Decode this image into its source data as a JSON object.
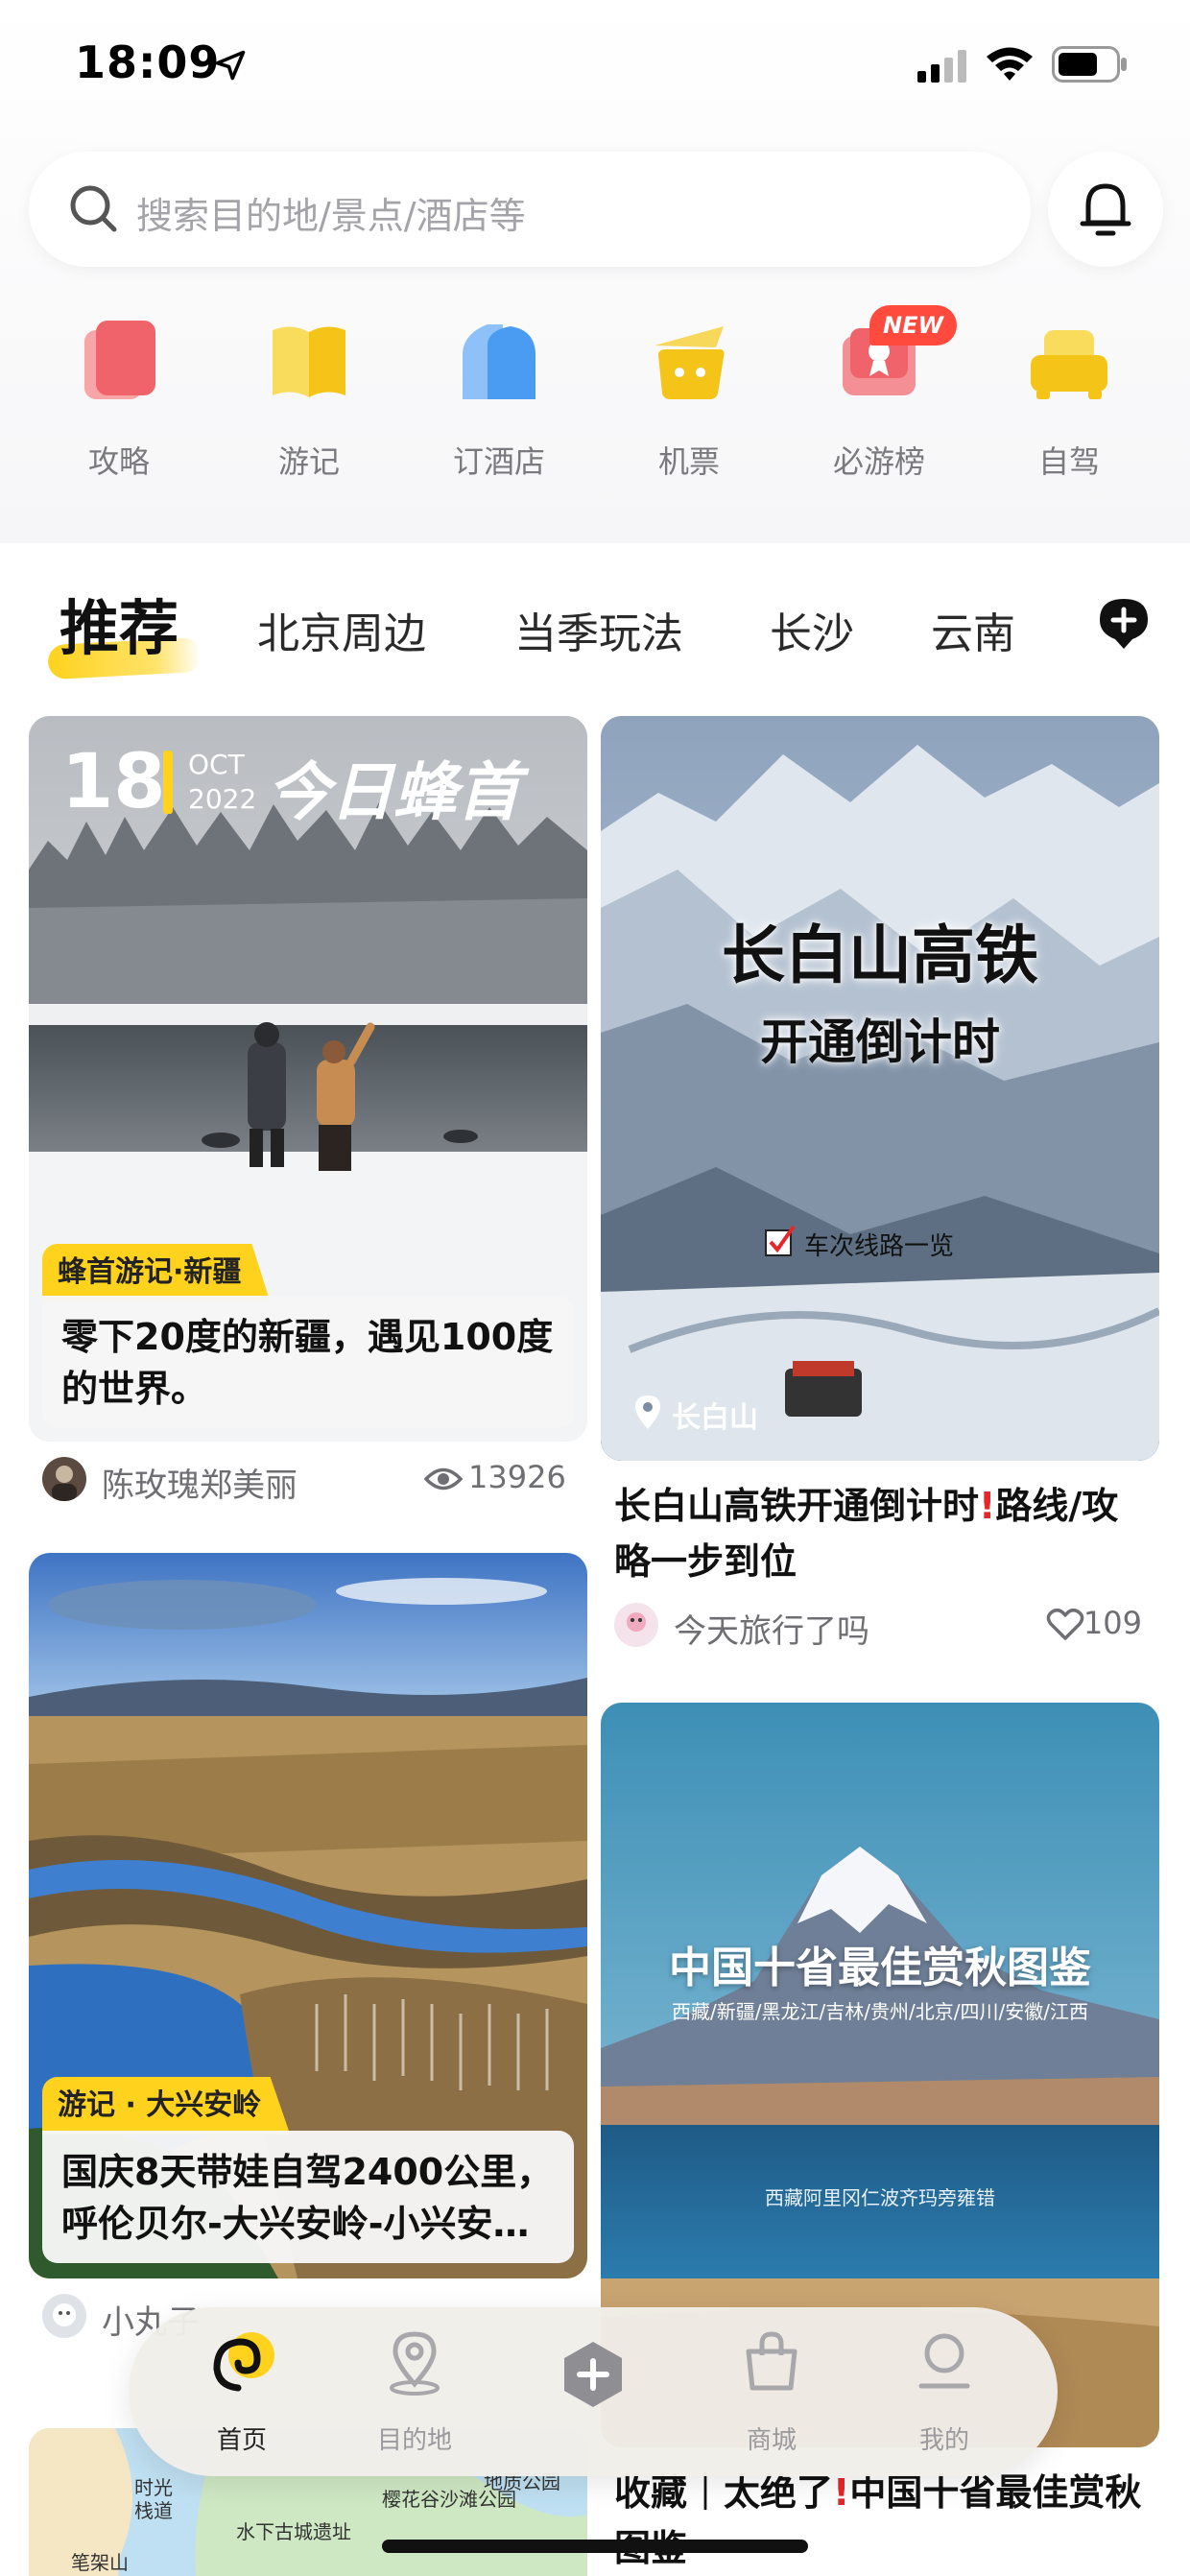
{
  "status_bar": {
    "time": "18:09"
  },
  "search": {
    "placeholder": "搜索目的地/景点/酒店等"
  },
  "quick_nav": [
    {
      "label": "攻略",
      "icon": "guide-icon",
      "color": "#f0636a"
    },
    {
      "label": "游记",
      "icon": "travelnote-icon",
      "color": "#f7cf2c"
    },
    {
      "label": "订酒店",
      "icon": "hotel-icon",
      "color": "#4a9cf3"
    },
    {
      "label": "机票",
      "icon": "flight-icon",
      "color": "#f7d02e"
    },
    {
      "label": "必游榜",
      "icon": "ranking-icon",
      "color": "#f06670",
      "badge": "NEW"
    },
    {
      "label": "自驾",
      "icon": "car-icon",
      "color": "#f8c91f"
    }
  ],
  "tabs": {
    "active": "推荐",
    "items": [
      "北京周边",
      "当季玩法",
      "长沙",
      "云南"
    ]
  },
  "cards": {
    "c1": {
      "date_day": "18",
      "date_month": "OCT",
      "date_year": "2022",
      "banner": "今日蜂首",
      "tag": "蜂首游记·新疆",
      "title": "零下20度的新疆，遇见100度的世界。",
      "author": "陈玫瑰郑美丽",
      "views": "13926"
    },
    "c2": {
      "img_title": "长白山高铁",
      "img_subtitle": "开通倒计时",
      "img_caption": "车次线路一览",
      "location": "长白山",
      "title_a": "长白山高铁开通倒计时",
      "title_b": "路线/攻略一步到位",
      "author": "今天旅行了吗",
      "likes": "109"
    },
    "c3": {
      "tag": "游记 · 大兴安岭",
      "title": "国庆8天带娃自驾2400公里，呼伦贝尔-大兴安岭-小兴安…",
      "author": "小丸子"
    },
    "c4": {
      "img_title": "中国十省最佳赏秋图鉴",
      "img_subtitle": "西藏/新疆/黑龙江/吉林/贵州/北京/四川/安徽/江西",
      "img_caption": "西藏阿里冈仁波齐玛旁雍错",
      "title_a": "收藏｜太绝了",
      "title_b": "中国十省最佳赏秋图鉴"
    },
    "c5": {
      "map_labels": [
        "时光栈道",
        "樱花谷沙滩公园",
        "地质公园",
        "水下古城遗址",
        "笔架山"
      ]
    }
  },
  "bottom_nav": [
    {
      "label": "首页",
      "icon": "home-icon",
      "active": true
    },
    {
      "label": "目的地",
      "icon": "destination-icon",
      "active": false
    },
    {
      "label": "",
      "icon": "plus-icon",
      "active": false
    },
    {
      "label": "商城",
      "icon": "shop-icon",
      "active": false
    },
    {
      "label": "我的",
      "icon": "profile-icon",
      "active": false
    }
  ],
  "colors": {
    "accent_yellow": "#ffd21e",
    "tag_red": "#e8262a",
    "text_grey": "#6f6f73"
  }
}
